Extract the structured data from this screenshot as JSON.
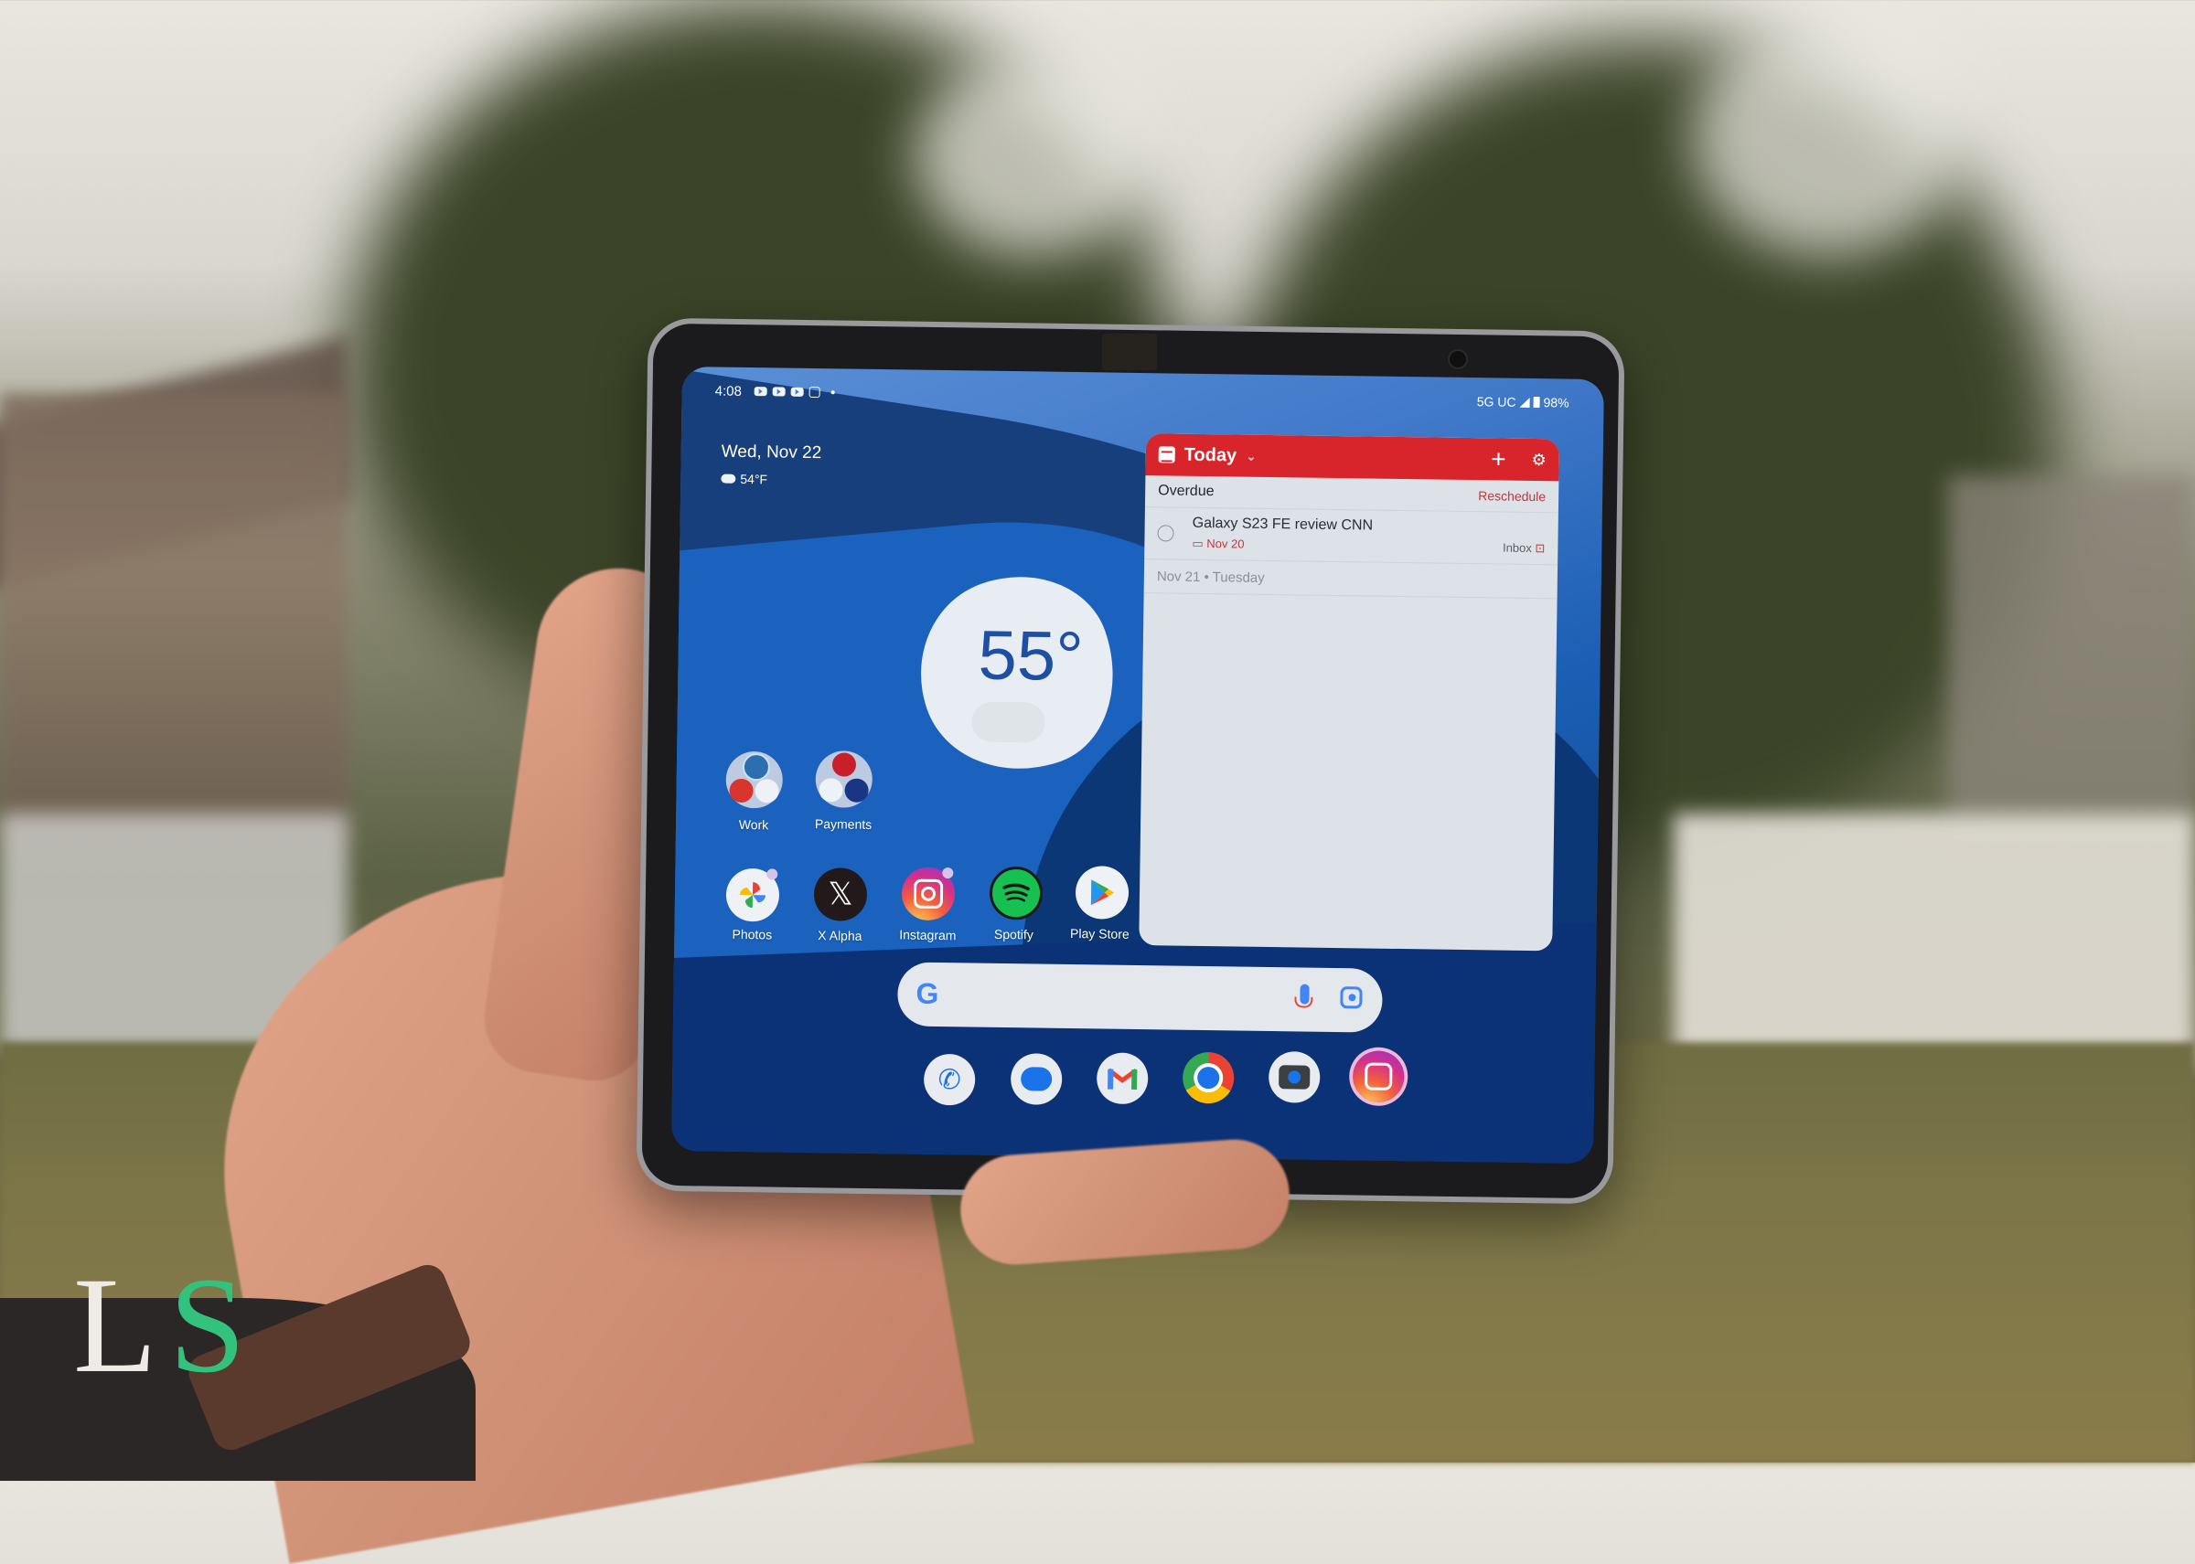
{
  "status_bar": {
    "time": "4:08",
    "notification_icons": [
      "youtube-icon",
      "youtube-icon",
      "youtube-icon",
      "instagram-icon"
    ],
    "network": "5G UC",
    "battery": "98%"
  },
  "home": {
    "date": "Wed, Nov 22",
    "weather_small": "54°F",
    "weather_widget_temp": "55°"
  },
  "todo_widget": {
    "title": "Today",
    "add_icon": "+",
    "settings_icon": "⚙",
    "section_label": "Overdue",
    "reschedule_label": "Reschedule",
    "tasks": [
      {
        "title": "Galaxy S23 FE review CNN",
        "due": "Nov 20",
        "project": "Inbox"
      }
    ],
    "next_day_label": "Nov 21 • Tuesday",
    "accent_color": "#d8252b"
  },
  "folders": [
    {
      "label": "Work",
      "apps": [
        "wordpress-icon",
        "todoist-icon",
        "youtube-studio-icon"
      ]
    },
    {
      "label": "Payments",
      "apps": [
        "wells-fargo-icon",
        "google-wallet-icon",
        "paypal-icon"
      ]
    }
  ],
  "apps": [
    {
      "label": "Photos",
      "icon": "google-photos-icon"
    },
    {
      "label": "X Alpha",
      "icon": "x-icon"
    },
    {
      "label": "Instagram",
      "icon": "instagram-icon"
    },
    {
      "label": "Spotify",
      "icon": "spotify-icon"
    },
    {
      "label": "Play Store",
      "icon": "play-store-icon"
    }
  ],
  "search_bar": {
    "logo": "G",
    "mic_icon": "mic-icon",
    "lens_icon": "google-lens-icon"
  },
  "dock": [
    {
      "icon": "phone-icon"
    },
    {
      "icon": "messages-icon"
    },
    {
      "icon": "gmail-icon"
    },
    {
      "icon": "chrome-icon"
    },
    {
      "icon": "camera-icon"
    },
    {
      "icon": "instagram-icon"
    }
  ],
  "watermark": {
    "l": "L",
    "s": "S"
  }
}
